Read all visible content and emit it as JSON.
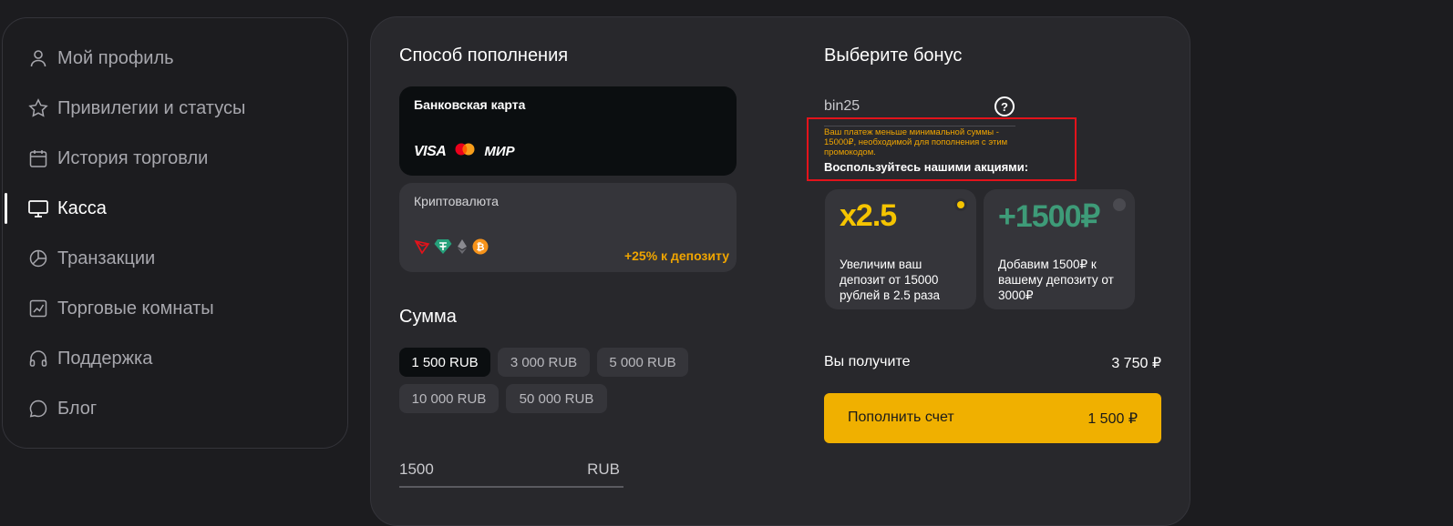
{
  "sidebar": {
    "items": [
      {
        "label": "Мой профиль",
        "icon": "user-icon"
      },
      {
        "label": "Привилегии и статусы",
        "icon": "star-icon"
      },
      {
        "label": "История торговли",
        "icon": "calendar-icon"
      },
      {
        "label": "Касса",
        "icon": "monitor-icon",
        "active": true
      },
      {
        "label": "Транзакции",
        "icon": "pie-chart-icon"
      },
      {
        "label": "Торговые комнаты",
        "icon": "chart-icon"
      },
      {
        "label": "Поддержка",
        "icon": "headphones-icon"
      },
      {
        "label": "Блог",
        "icon": "chat-icon"
      }
    ]
  },
  "method": {
    "title": "Способ пополнения",
    "bank": {
      "label": "Банковская карта",
      "visa": "VISA",
      "mir": "МИР"
    },
    "crypto": {
      "label": "Криптовалюта",
      "bonus": "+25% к депозиту"
    }
  },
  "amount": {
    "title": "Сумма",
    "chips": [
      "1 500 RUB",
      "3 000 RUB",
      "5 000 RUB",
      "10 000 RUB",
      "50 000 RUB"
    ],
    "selected": "1 500 RUB",
    "input_value": "1500",
    "currency": "RUB"
  },
  "bonus": {
    "title": "Выберите бонус",
    "promo_code": "bin25",
    "help": "?",
    "warning": "Ваш платеж меньше минимальной суммы - 15000₽, необходимой для пополнения с этим промокодом.",
    "call_to_action": "Воспользуйтесь нашими акциями:",
    "offers": [
      {
        "big": "x2.5",
        "desc": "Увеличим ваш депозит от 15000 рублей в 2.5 раза",
        "color": "#f5c400",
        "selected": true
      },
      {
        "big": "+1500₽",
        "desc": "Добавим 1500₽ к вашему депозиту от 3000₽",
        "color": "#3e9b78",
        "selected": false
      }
    ]
  },
  "summary": {
    "receive_label": "Вы получите",
    "receive_value": "3 750 ₽",
    "button_label": "Пополнить счет",
    "button_amount": "1 500 ₽"
  },
  "colors": {
    "accent": "#f0b000",
    "warning_border": "#e3131b",
    "warning_text": "#f0a500"
  }
}
